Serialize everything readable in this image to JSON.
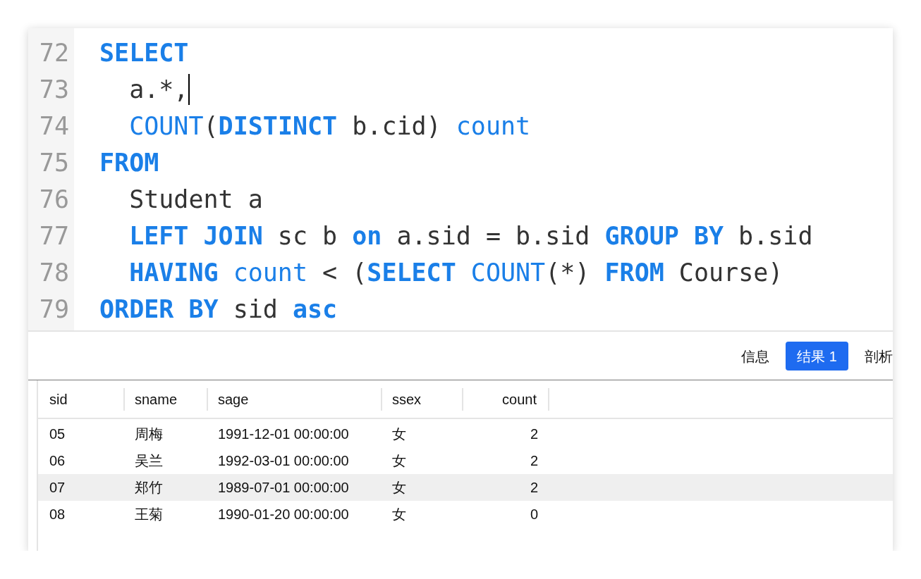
{
  "editor": {
    "lines": [
      {
        "number": "72",
        "caret": false,
        "tokens": [
          {
            "kind": "keyword",
            "text": "SELECT"
          }
        ]
      },
      {
        "number": "73",
        "caret": true,
        "tokens": [
          {
            "kind": "plain",
            "text": "  a.*,"
          }
        ]
      },
      {
        "number": "74",
        "caret": false,
        "tokens": [
          {
            "kind": "function",
            "text": "  COUNT"
          },
          {
            "kind": "plain",
            "text": "("
          },
          {
            "kind": "keyword",
            "text": "DISTINCT"
          },
          {
            "kind": "plain",
            "text": " b.cid) "
          },
          {
            "kind": "function",
            "text": "count"
          }
        ]
      },
      {
        "number": "75",
        "caret": false,
        "tokens": [
          {
            "kind": "keyword",
            "text": "FROM"
          }
        ]
      },
      {
        "number": "76",
        "caret": false,
        "tokens": [
          {
            "kind": "plain",
            "text": "  Student a"
          }
        ]
      },
      {
        "number": "77",
        "caret": false,
        "tokens": [
          {
            "kind": "keyword",
            "text": "  LEFT JOIN"
          },
          {
            "kind": "plain",
            "text": " sc b "
          },
          {
            "kind": "keyword",
            "text": "on"
          },
          {
            "kind": "plain",
            "text": " a.sid = b.sid "
          },
          {
            "kind": "keyword",
            "text": "GROUP BY"
          },
          {
            "kind": "plain",
            "text": " b.sid"
          }
        ]
      },
      {
        "number": "78",
        "caret": false,
        "tokens": [
          {
            "kind": "keyword",
            "text": "  HAVING"
          },
          {
            "kind": "function",
            "text": " count"
          },
          {
            "kind": "plain",
            "text": " < ("
          },
          {
            "kind": "keyword",
            "text": "SELECT"
          },
          {
            "kind": "function",
            "text": " COUNT"
          },
          {
            "kind": "plain",
            "text": "(*) "
          },
          {
            "kind": "keyword",
            "text": "FROM"
          },
          {
            "kind": "plain",
            "text": " Course)"
          }
        ]
      },
      {
        "number": "79",
        "caret": false,
        "tokens": [
          {
            "kind": "keyword",
            "text": "ORDER BY"
          },
          {
            "kind": "plain",
            "text": " sid "
          },
          {
            "kind": "keyword",
            "text": "asc"
          }
        ]
      }
    ]
  },
  "tabs": [
    {
      "label": "信息",
      "selected": false
    },
    {
      "label": "结果 1",
      "selected": true
    },
    {
      "label": "剖析",
      "selected": false
    }
  ],
  "table": {
    "columns": [
      {
        "label": "sid",
        "kind": "text"
      },
      {
        "label": "sname",
        "kind": "text"
      },
      {
        "label": "sage",
        "kind": "text"
      },
      {
        "label": "ssex",
        "kind": "text"
      },
      {
        "label": "count",
        "kind": "number"
      }
    ],
    "rows": [
      {
        "selected": false,
        "cells": [
          "05",
          "周梅",
          "1991-12-01 00:00:00",
          "女",
          "2"
        ]
      },
      {
        "selected": false,
        "cells": [
          "06",
          "吴兰",
          "1992-03-01 00:00:00",
          "女",
          "2"
        ]
      },
      {
        "selected": true,
        "cells": [
          "07",
          "郑竹",
          "1989-07-01 00:00:00",
          "女",
          "2"
        ]
      },
      {
        "selected": false,
        "cells": [
          "08",
          "王菊",
          "1990-01-20 00:00:00",
          "女",
          "0"
        ]
      }
    ]
  }
}
